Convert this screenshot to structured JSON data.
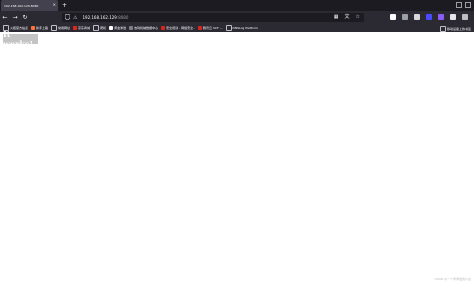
{
  "tab": {
    "title": "192.168.162.129:8080",
    "close_icon": "×",
    "new_tab": "+"
  },
  "nav": {
    "back_icon": "←",
    "forward_icon": "→",
    "reload_icon": "↻",
    "url_host": "192.168.162.129",
    "url_port": ":8080",
    "shield_icon": "shield-icon",
    "lock_icon": "⚠",
    "qr_icon": "▦",
    "translate_icon": "文",
    "star_icon": "☆"
  },
  "bookmarks": {
    "items": [
      {
        "label": "火狐官方站点",
        "color": "#7f7f86"
      },
      {
        "label": "新手上路",
        "color": "#ff7139"
      },
      {
        "label": "常用网址",
        "color": "#7f7f86"
      },
      {
        "label": "京东商城",
        "color": "#e1251b"
      },
      {
        "label": "靶机",
        "color": "#7f7f86"
      },
      {
        "label": "黄金渗透",
        "color": "#000000"
      },
      {
        "label": "吉利机械数据中心",
        "color": "#7f7f86"
      },
      {
        "label": "安全培训 - 网络安全..",
        "color": "#d7261b"
      },
      {
        "label": "腾讯云 SCF ...",
        "color": "#d7261b"
      },
      {
        "label": "DNSLog Platform",
        "color": "#7f7f86"
      }
    ],
    "other_label": "移动设备上的书签"
  },
  "content": {
    "heading": "It works!",
    "watermark": "CSDN @一个学渗透的小白"
  },
  "colors": {
    "tabbar_bg": "#1c1b22",
    "toolbar_bg": "#2b2a33",
    "tab_active": "#42414d",
    "heading_bg": "#c4c4c4"
  }
}
